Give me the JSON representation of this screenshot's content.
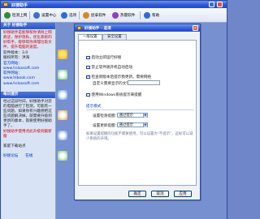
{
  "window": {
    "title": "好搜助手"
  },
  "toolbar": {
    "items": [
      {
        "label": "检测上网",
        "icon": "globe-icon",
        "color": "#2f8f2f"
      },
      {
        "label": "设置中心",
        "icon": "settings-icon",
        "color": "#3b6fd6"
      },
      {
        "label": "选项",
        "icon": "check-icon",
        "color": "#2e6bd9"
      },
      {
        "label": "捉拿软件",
        "icon": "capture-icon",
        "color": "#d58a21"
      },
      {
        "label": "热键软件",
        "icon": "hotkey-icon",
        "color": "#8e3fc6"
      },
      {
        "label": "帮助",
        "icon": "help-icon",
        "color": "#2e6bd9"
      }
    ]
  },
  "left_panel": {
    "about_title": "关于 好搜助手",
    "about_desc": "好搜助手是能够帮你清除上网痕迹，保护隐私，优化系统的好帮手，能够帮你清理垃圾文件，提升电脑的速度。",
    "info": [
      "软件版本：3.0",
      "版权所有：洪海",
      "官方网站：www.hslaosoft.com",
      "软件网站：www.hlbook.com",
      "www.hslaosoft.com"
    ],
    "tips_title": "每日提示",
    "tips_text": "经过这段时间，好搜助手对您的电脑进行了检测，可能有一些问题，如果你有兴趣想把这些问题解决掉，就需要升级到更新的版本，就要使用好搜助手了。",
    "link_red": "好搜助手使用点此升级到最新版",
    "footer_label": "家庭下载站点",
    "footer_links": [
      "好搜论坛",
      "在线"
    ]
  },
  "dialog": {
    "title": "好搜助手 - 选项",
    "tabs": [
      "一般设置",
      "安全设置"
    ],
    "options": [
      {
        "label": "启动立即运行好搜",
        "checked": false
      },
      {
        "label": "禁止软件随开机自动启动",
        "checked": false
      },
      {
        "label": "检查新版本后提示我更新，需要网络",
        "checked": true
      },
      {
        "label": "使用Windows系统提示来提醒",
        "checked": false
      }
    ],
    "sub_label": "自定义需要显示的文字：",
    "group_title": "提示模式",
    "selects": [
      {
        "label": "设置检测提醒：",
        "value": "通过提示"
      },
      {
        "label": "设置更新提醒：",
        "value": "通过提示"
      }
    ],
    "note": "如果设置提醒的功能不需要使用，可以设置为\"不提示\"，这样可以减少系统的开销。",
    "buttons": {
      "ok": "确定",
      "cancel": "取消",
      "apply": "应用"
    }
  }
}
